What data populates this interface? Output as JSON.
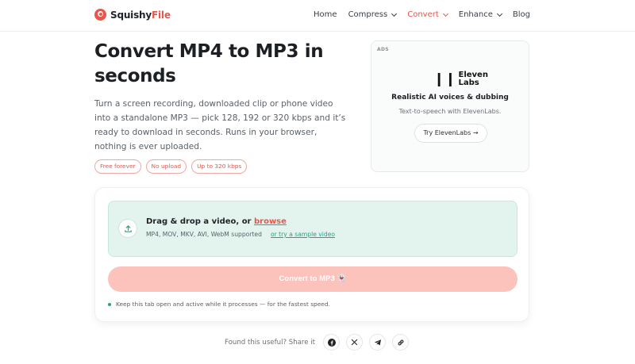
{
  "brand": {
    "name_part1": "Squishy",
    "name_part2": "File"
  },
  "nav": {
    "home": "Home",
    "compress": "Compress",
    "convert": "Convert",
    "enhance": "Enhance",
    "blog": "Blog"
  },
  "hero": {
    "title": "Convert MP4 to MP3 in seconds",
    "description": "Turn a screen recording, downloaded clip or phone video into a standalone MP3 — pick 128, 192 or 320 kbps and it’s ready to download in seconds. Runs in your browser, nothing is ever uploaded.",
    "pills": [
      "Free forever",
      "No upload",
      "Up to 320 kbps"
    ]
  },
  "ad": {
    "tag": "ADS",
    "logo_line1": "Eleven",
    "logo_line2": "Labs",
    "headline": "Realistic AI voices & dubbing",
    "subtext": "Text-to-speech with ElevenLabs.",
    "cta": "Try ElevenLabs →"
  },
  "converter": {
    "drop_title": "Drag & drop a video, or ",
    "browse": "browse",
    "formats": "MP4, MOV, MKV, AVI, WebM supported",
    "sample_link": "or try a sample video",
    "convert_button": "Convert to MP3 👻",
    "hint": "Keep this tab open and active while it processes — for the fastest speed."
  },
  "share": {
    "label": "Found this useful? Share it"
  },
  "colors": {
    "accent": "#e8564b",
    "teal": "#2aa185",
    "drop_bg": "#e3f4ee",
    "button_disabled": "#fcc3bd"
  }
}
